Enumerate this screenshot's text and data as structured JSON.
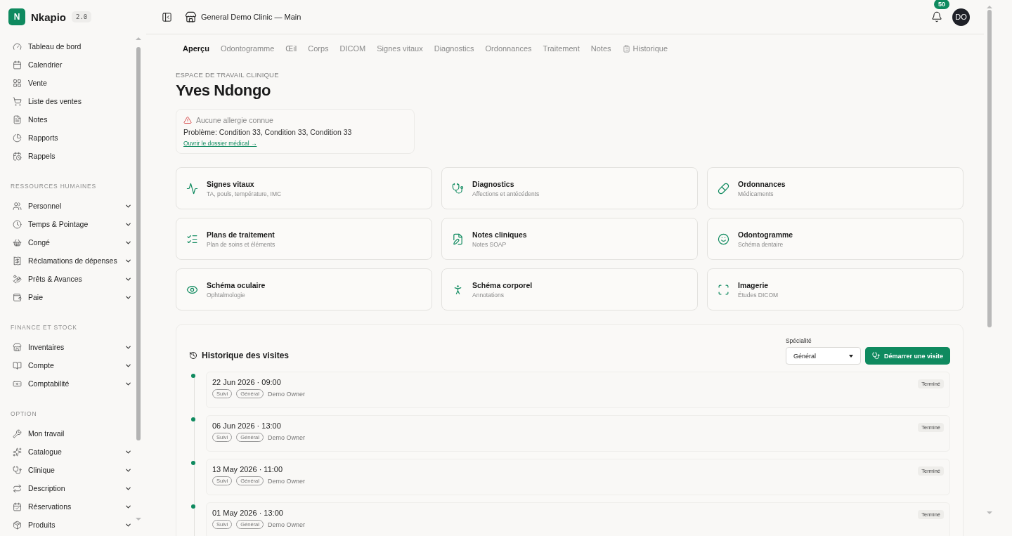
{
  "brand": {
    "logo": "N",
    "name": "Nkapio",
    "version": "2.0"
  },
  "header": {
    "clinic": "General Demo Clinic — Main",
    "notifications": "50",
    "avatar": "DO"
  },
  "sidebar": {
    "items": [
      {
        "label": "Tableau de bord",
        "expandable": false
      },
      {
        "label": "Calendrier",
        "expandable": false
      },
      {
        "label": "Vente",
        "expandable": false
      },
      {
        "label": "Liste des ventes",
        "expandable": false
      },
      {
        "label": "Notes",
        "expandable": false
      },
      {
        "label": "Rapports",
        "expandable": false
      },
      {
        "label": "Rappels",
        "expandable": false
      }
    ],
    "sections": [
      {
        "title": "RESSOURCES HUMAINES",
        "items": [
          {
            "label": "Personnel",
            "expandable": true
          },
          {
            "label": "Temps & Pointage",
            "expandable": true
          },
          {
            "label": "Congé",
            "expandable": true
          },
          {
            "label": "Réclamations de dépenses",
            "expandable": true
          },
          {
            "label": "Prêts & Avances",
            "expandable": true
          },
          {
            "label": "Paie",
            "expandable": true
          }
        ]
      },
      {
        "title": "FINANCE ET STOCK",
        "items": [
          {
            "label": "Inventaires",
            "expandable": true
          },
          {
            "label": "Compte",
            "expandable": true
          },
          {
            "label": "Comptabilité",
            "expandable": true
          }
        ]
      },
      {
        "title": "OPTION",
        "items": [
          {
            "label": "Mon travail",
            "expandable": false
          },
          {
            "label": "Catalogue",
            "expandable": true
          },
          {
            "label": "Clinique",
            "expandable": true
          },
          {
            "label": "Description",
            "expandable": true
          },
          {
            "label": "Réservations",
            "expandable": true
          },
          {
            "label": "Produits",
            "expandable": true
          }
        ]
      }
    ]
  },
  "tabs": [
    {
      "label": "Aperçu",
      "selected": true,
      "kind": "plain"
    },
    {
      "label": "Odontogramme",
      "selected": false,
      "kind": "plain"
    },
    {
      "label": "Œil",
      "selected": false,
      "kind": "plain"
    },
    {
      "label": "Corps",
      "selected": false,
      "kind": "plain"
    },
    {
      "label": "DICOM",
      "selected": false,
      "kind": "plain"
    },
    {
      "label": "Signes vitaux",
      "selected": false,
      "kind": "plain"
    },
    {
      "label": "Diagnostics",
      "selected": false,
      "kind": "plain"
    },
    {
      "label": "Ordonnances",
      "selected": false,
      "kind": "plain"
    },
    {
      "label": "Traitement",
      "selected": false,
      "kind": "plain"
    },
    {
      "label": "Notes",
      "selected": false,
      "kind": "plain"
    },
    {
      "label": "Historique",
      "selected": false,
      "kind": "icon"
    }
  ],
  "patient": {
    "eyebrow": "ESPACE DE TRAVAIL CLINIQUE",
    "name": "Yves Ndongo",
    "allergy": "Aucune allergie connue",
    "problems": "Problème: Condition 33, Condition 33, Condition 33",
    "link": "Ouvrir le dossier médical →"
  },
  "cards": [
    {
      "title": "Signes vitaux",
      "subtitle": "TA, pouls, température, IMC"
    },
    {
      "title": "Diagnostics",
      "subtitle": "Affections et antécédents"
    },
    {
      "title": "Ordonnances",
      "subtitle": "Médicaments"
    },
    {
      "title": "Plans de traitement",
      "subtitle": "Plan de soins et éléments"
    },
    {
      "title": "Notes cliniques",
      "subtitle": "Notes SOAP"
    },
    {
      "title": "Odontogramme",
      "subtitle": "Schéma dentaire"
    },
    {
      "title": "Schéma oculaire",
      "subtitle": "Ophtalmologie"
    },
    {
      "title": "Schéma corporel",
      "subtitle": "Annotations"
    },
    {
      "title": "Imagerie",
      "subtitle": "Études DICOM"
    }
  ],
  "visits": {
    "title": "Historique des visites",
    "specialty_label": "Spécialité",
    "specialty_value": "Général",
    "start_button": "Démarrer une visite",
    "items": [
      {
        "date": "22 Jun 2026 · 09:00",
        "tags": [
          "Suivi",
          "Général"
        ],
        "owner": "Demo Owner",
        "status": "Terminé"
      },
      {
        "date": "06 Jun 2026 · 13:00",
        "tags": [
          "Suivi",
          "Général"
        ],
        "owner": "Demo Owner",
        "status": "Terminé"
      },
      {
        "date": "13 May 2026 · 11:00",
        "tags": [
          "Suivi",
          "Général"
        ],
        "owner": "Demo Owner",
        "status": "Terminé"
      },
      {
        "date": "01 May 2026 · 13:00",
        "tags": [
          "Suivi",
          "Général"
        ],
        "owner": "Demo Owner",
        "status": "Terminé"
      }
    ]
  }
}
